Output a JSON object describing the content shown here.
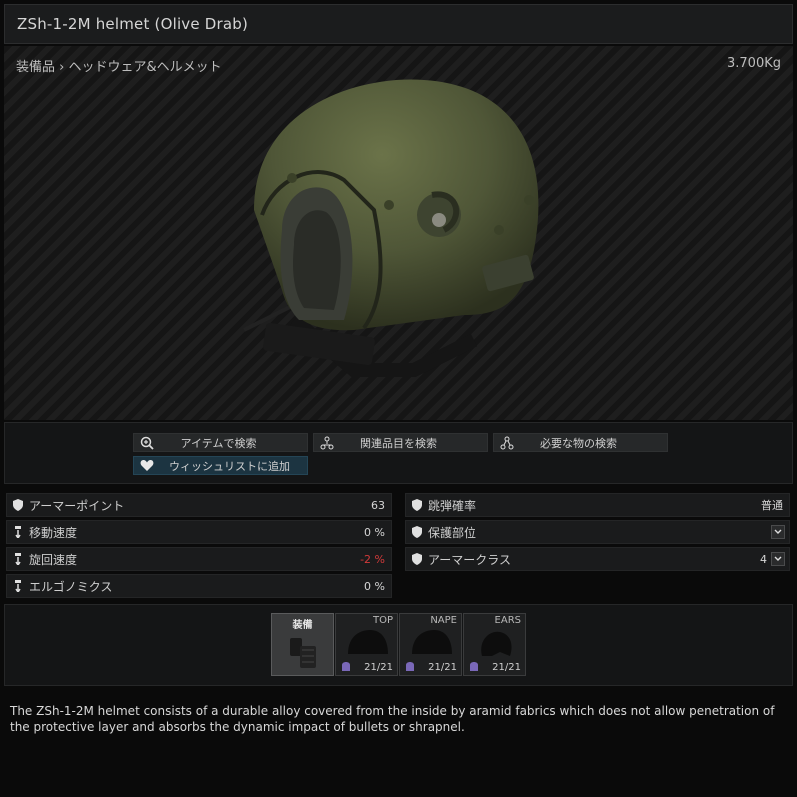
{
  "window": {
    "title": "ZSh-1-2M helmet (Olive Drab)"
  },
  "breadcrumb": {
    "category": "装備品",
    "separator": "›",
    "subcategory": "ヘッドウェア&ヘルメット"
  },
  "weight": "3.700Kg",
  "actions": {
    "search_item": "アイテムで検索",
    "search_related": "関連品目を検索",
    "search_required": "必要な物の検索",
    "wishlist": "ウィッシュリストに追加"
  },
  "stats_left": [
    {
      "label": "アーマーポイント",
      "value": "63",
      "icon": "shield-icon"
    },
    {
      "label": "移動速度",
      "value": "0 %",
      "icon": "stat-icon"
    },
    {
      "label": "旋回速度",
      "value": "-2 %",
      "icon": "stat-icon",
      "negative": true
    },
    {
      "label": "エルゴノミクス",
      "value": "0 %",
      "icon": "stat-icon"
    }
  ],
  "stats_right": [
    {
      "label": "跳弾確率",
      "value": "普通",
      "icon": "shield-icon"
    },
    {
      "label": "保護部位",
      "value": "",
      "icon": "shield-icon",
      "dropdown": true
    },
    {
      "label": "アーマークラス",
      "value": "4",
      "icon": "shield-icon",
      "dropdown": true
    }
  ],
  "slots": [
    {
      "label": "装備",
      "count": ""
    },
    {
      "label": "TOP",
      "count": "21/21"
    },
    {
      "label": "NAPE",
      "count": "21/21"
    },
    {
      "label": "EARS",
      "count": "21/21"
    }
  ],
  "description": "The ZSh-1-2M helmet consists of a durable alloy covered from the inside by aramid fabrics which does not allow penetration of the protective layer and absorbs the dynamic impact of bullets or shrapnel.",
  "colors": {
    "helmet": "#4f5637",
    "wishlist_bg": "#1c3441",
    "negative": "#d23a3a"
  }
}
